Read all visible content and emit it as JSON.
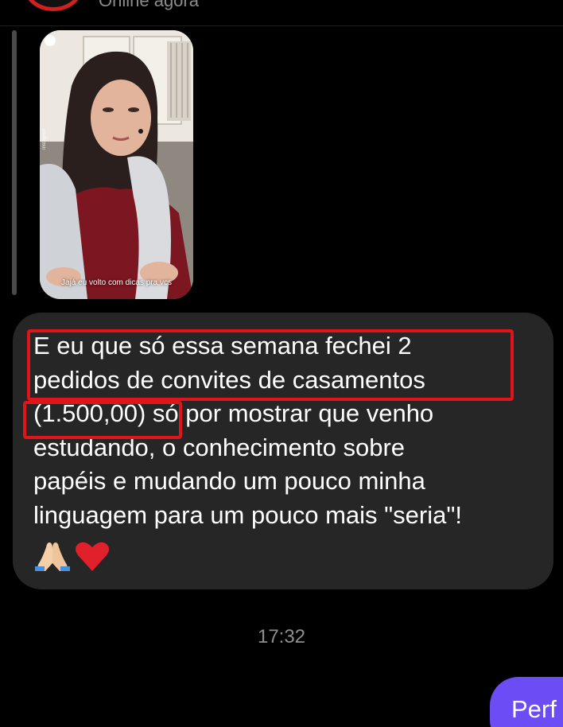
{
  "header": {
    "status": "Online agora",
    "avatar_color": "#d21f1f"
  },
  "reply": {
    "story_caption": "Jajá eu volto com dicas pra vcs",
    "story_watermark": "Instagram"
  },
  "message": {
    "lines": [
      "E eu que só essa semana fechei 2",
      "pedidos de convites de casamentos",
      "(1.500,00) só por mostrar que venho",
      "estudando, o conhecimento sobre",
      "papéis e mudando um pouco minha",
      "linguagem para um pouco mais \"seria\"!"
    ],
    "emojis": [
      "folded-hands",
      "red-heart"
    ],
    "bubble_color": "#262626"
  },
  "timestamp": "17:32",
  "sent_message": {
    "preview": "Perf",
    "bubble_color": "#6b4cf5"
  },
  "highlight_color": "#e0141b"
}
